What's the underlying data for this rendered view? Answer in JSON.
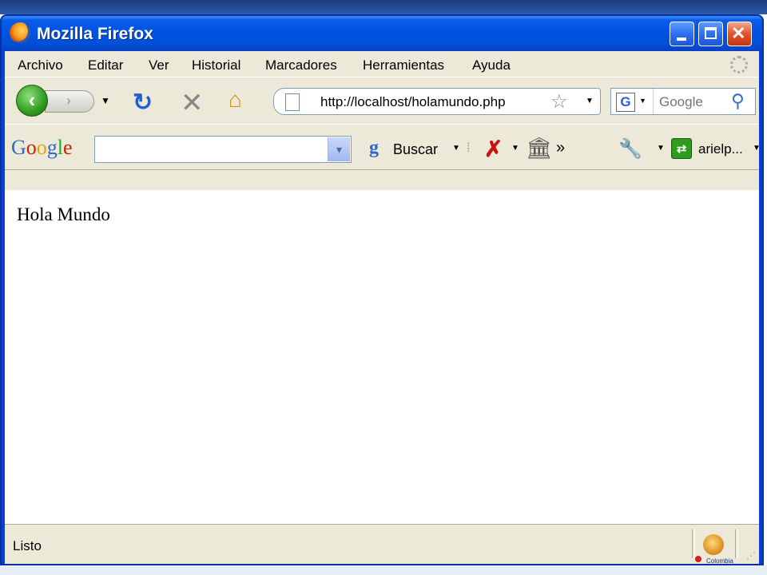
{
  "window": {
    "title": "Mozilla Firefox"
  },
  "menubar": {
    "items": [
      "Archivo",
      "Editar",
      "Ver",
      "Historial",
      "Marcadores",
      "Herramientas",
      "Ayuda"
    ]
  },
  "navbar": {
    "url": "http://localhost/holamundo.php",
    "search_placeholder": "Google",
    "search_engine": "G"
  },
  "google_toolbar": {
    "logo": "Google",
    "search_button": "Buscar",
    "overflow": "»",
    "user": "arielp..."
  },
  "content": {
    "text": "Hola Mundo"
  },
  "status": {
    "text": "Listo"
  },
  "corner": {
    "label": "Colombia"
  },
  "icons": [
    "firefox-logo",
    "back-arrow",
    "forward-arrow",
    "reload",
    "stop",
    "home",
    "page",
    "star",
    "magnifier",
    "google-g",
    "x-mark",
    "bank",
    "wrench",
    "share",
    "smiley",
    "resize-grip"
  ],
  "colors": {
    "title_bar": "#0054e3",
    "chrome_bg": "#ece9d8",
    "close_button": "#e3532a"
  }
}
